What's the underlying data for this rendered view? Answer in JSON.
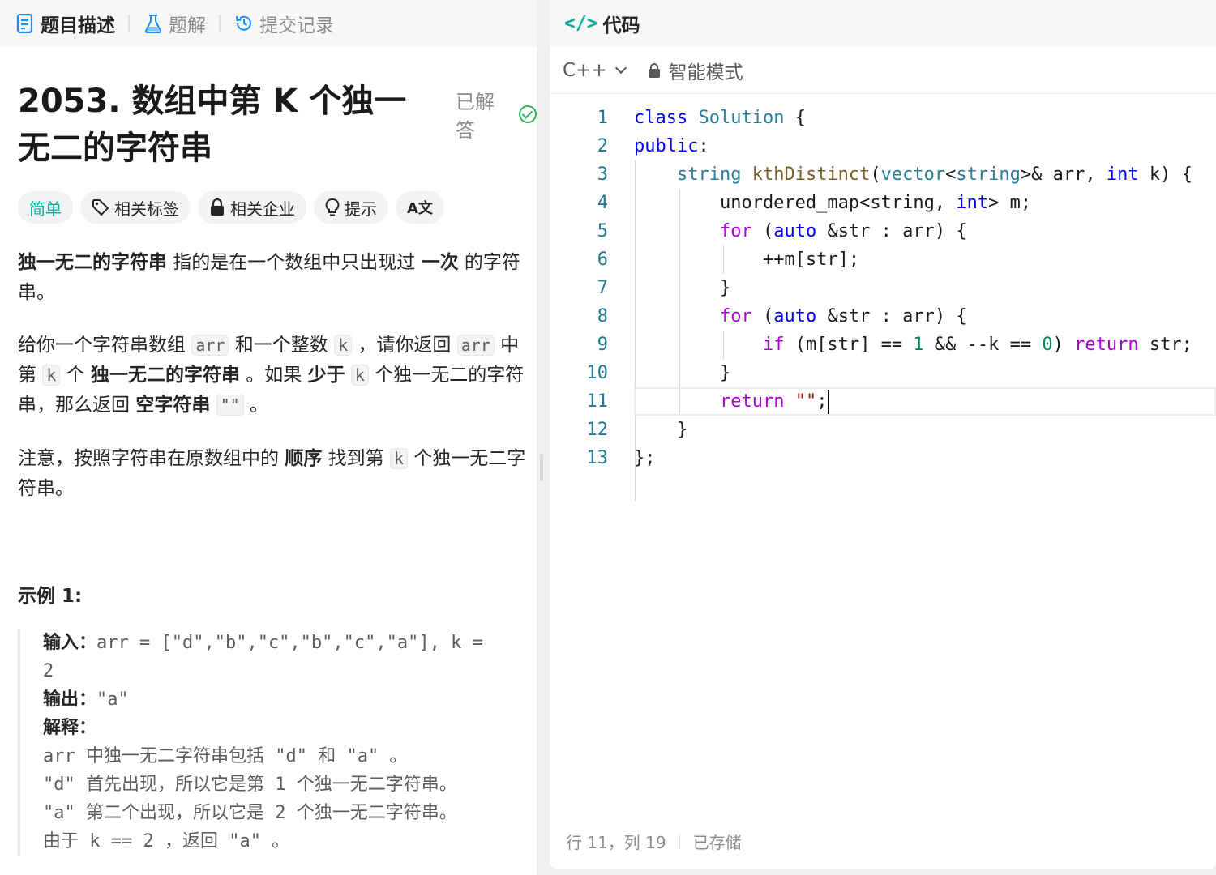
{
  "tabs": [
    {
      "label": "题目描述",
      "icon": "document-icon"
    },
    {
      "label": "题解",
      "icon": "flask-icon"
    },
    {
      "label": "提交记录",
      "icon": "history-icon"
    }
  ],
  "problem": {
    "title": "2053. 数组中第 K 个独一无二的字符串",
    "status": "已解答",
    "tags": [
      "简单",
      "相关标签",
      "相关企业",
      "提示",
      "A文"
    ],
    "para1": {
      "b1": "独一无二的字符串",
      "t1": " 指的是在一个数组中只出现过 ",
      "b2": "一次",
      "t2": " 的字符串。"
    },
    "para2": {
      "t1": "给你一个字符串数组 ",
      "c1": "arr",
      "t2": " 和一个整数 ",
      "c2": "k",
      "t3": " ，请你返回 ",
      "c3": "arr",
      "t4": " 中第 ",
      "c4": "k",
      "t5": " 个 ",
      "b1": "独一无二的字符串",
      "t6": " 。如果 ",
      "b2": "少于",
      "t7": " ",
      "c5": "k",
      "t8": " 个独一无二的字符串，那么返回 ",
      "b3": "空字符串",
      "t9": " ",
      "c6": "\"\"",
      "t10": " 。"
    },
    "para3": {
      "t1": "注意，按照字符串在原数组中的 ",
      "b1": "顺序",
      "t2": " 找到第 ",
      "c1": "k",
      "t3": " 个独一无二字符串。"
    },
    "example_title": "示例 1:",
    "example": {
      "in_label": "输入：",
      "in_val": "arr = [\"d\",\"b\",\"c\",\"b\",\"c\",\"a\"], k =",
      "in_val2": "2",
      "out_label": "输出：",
      "out_val": "\"a\"",
      "exp_label": "解释：",
      "exp1": "arr 中独一无二字符串包括 \"d\" 和 \"a\" 。",
      "exp2": "\"d\" 首先出现，所以它是第 1 个独一无二字符串。",
      "exp3": "\"a\" 第二个出现，所以它是 2 个独一无二字符串。",
      "exp4": "由于 k == 2 ，返回 \"a\" 。"
    }
  },
  "editor": {
    "header": "代码",
    "language": "C++",
    "mode": "智能模式",
    "line_numbers": [
      "1",
      "2",
      "3",
      "4",
      "5",
      "6",
      "7",
      "8",
      "9",
      "10",
      "11",
      "12",
      "13"
    ],
    "status_position": "行 11，列 19",
    "status_saved": "已存储"
  }
}
